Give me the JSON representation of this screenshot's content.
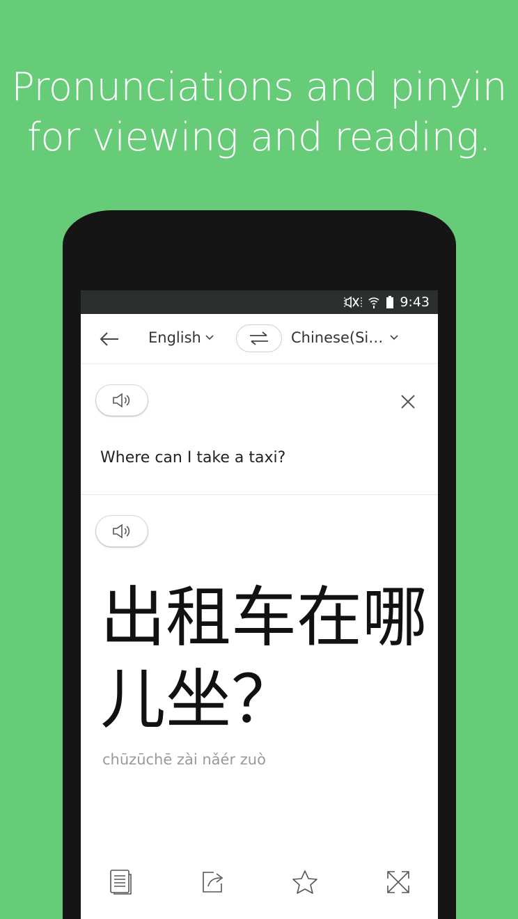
{
  "headline": {
    "line1": "Pronunciations and pinyin",
    "line2": "for viewing and reading."
  },
  "status_bar": {
    "time": "9:43",
    "icons": [
      "mute-icon",
      "wifi-icon",
      "battery-icon"
    ]
  },
  "toolbar": {
    "back_icon": "arrow-left-icon",
    "source_language": "English",
    "swap_icon": "swap-arrows-icon",
    "target_language": "Chinese(Si…"
  },
  "source": {
    "speak_icon": "speaker-icon",
    "clear_icon": "close-icon",
    "text": "Where can I take a taxi?"
  },
  "translation": {
    "speak_icon": "speaker-icon",
    "line1": "出租车在哪",
    "line2": "儿坐？",
    "pinyin": "chūzūchē zài nǎér zuò"
  },
  "bottom_actions": {
    "icons": [
      "copy-icon",
      "share-icon",
      "star-icon",
      "fullscreen-icon"
    ]
  },
  "colors": {
    "background": "#66cc77",
    "status_bar": "#2b302c",
    "pinyin": "#999999"
  }
}
